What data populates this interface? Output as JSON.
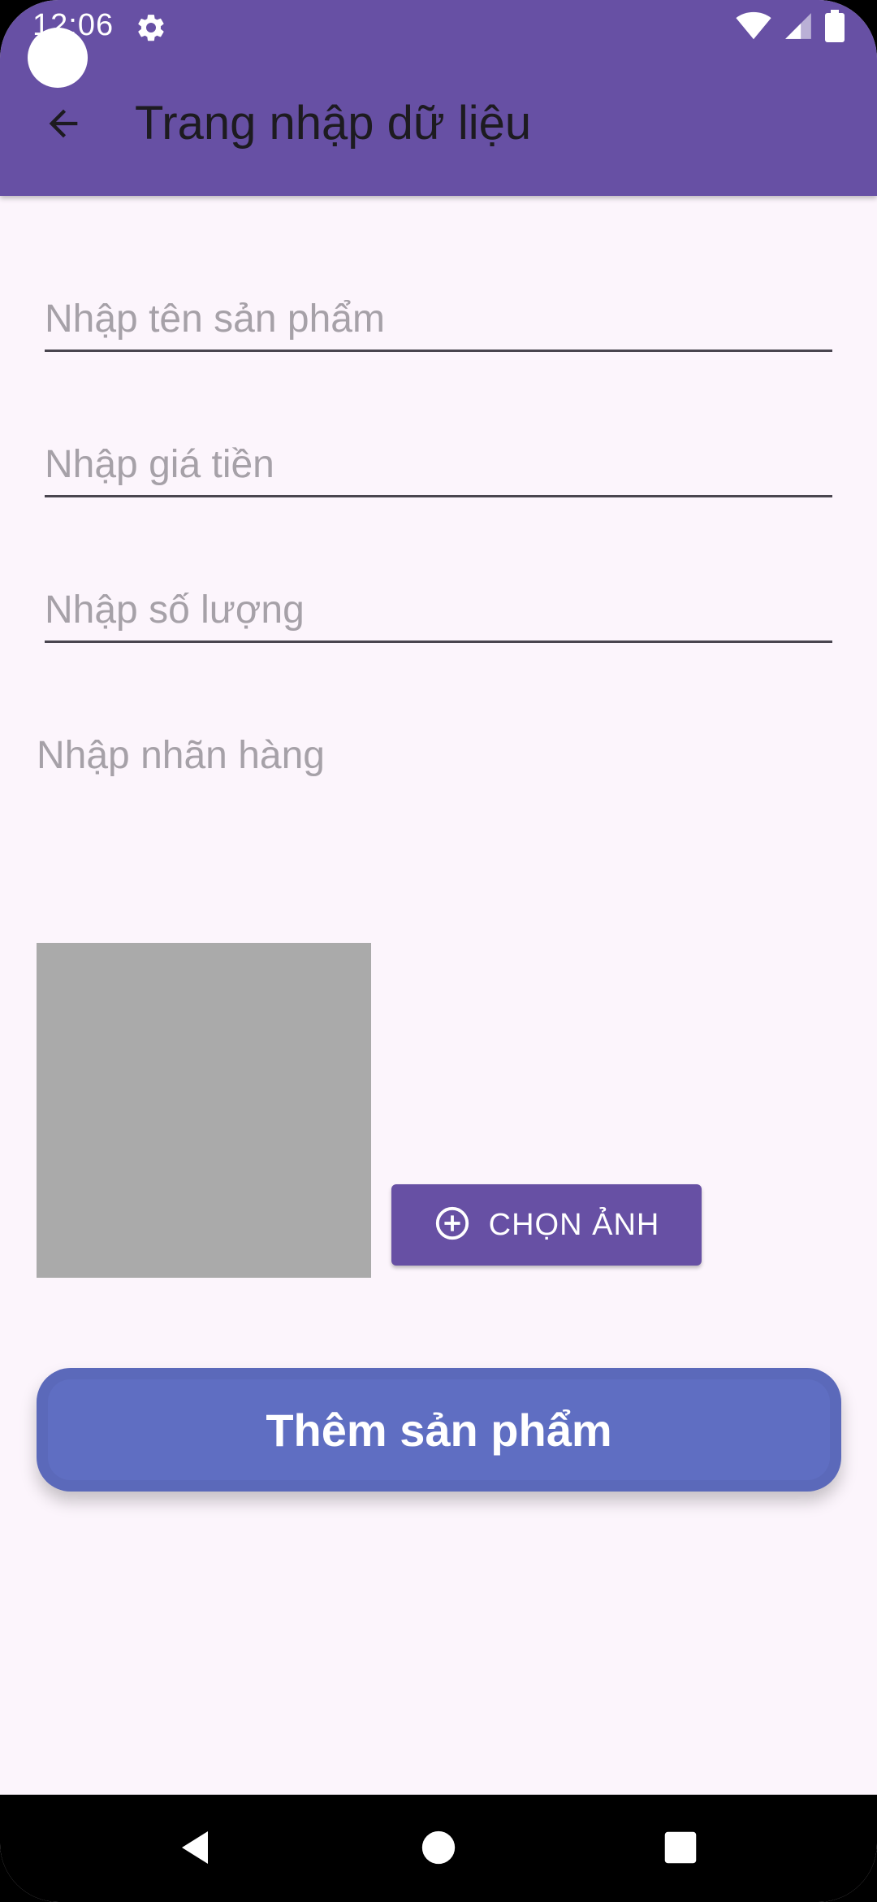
{
  "status_bar": {
    "time": "12:06",
    "icons": [
      "gear-icon",
      "wifi-icon",
      "cell-signal-icon",
      "battery-icon"
    ]
  },
  "toolbar": {
    "title": "Trang nhập dữ liệu",
    "back_icon": "arrow-left-icon"
  },
  "form": {
    "product_name": {
      "value": "",
      "placeholder": "Nhập tên sản phẩm"
    },
    "price": {
      "value": "",
      "placeholder": "Nhập giá tiền"
    },
    "quantity": {
      "value": "",
      "placeholder": "Nhập số lượng"
    },
    "brand": {
      "label": "Nhập nhãn hàng"
    }
  },
  "image_picker": {
    "button_label": "CHỌN ẢNH",
    "button_icon": "plus-circle-icon"
  },
  "submit": {
    "label": "Thêm sản phẩm"
  },
  "nav_bar": {
    "icons": [
      "back-triangle-icon",
      "home-circle-icon",
      "recents-square-icon"
    ]
  },
  "colors": {
    "primary": "#6750A4",
    "submit_button": "#5F6EC2",
    "background": "#FCF5FC",
    "placeholder": "#A6A1A8",
    "image_placeholder": "#AAAAAA"
  }
}
